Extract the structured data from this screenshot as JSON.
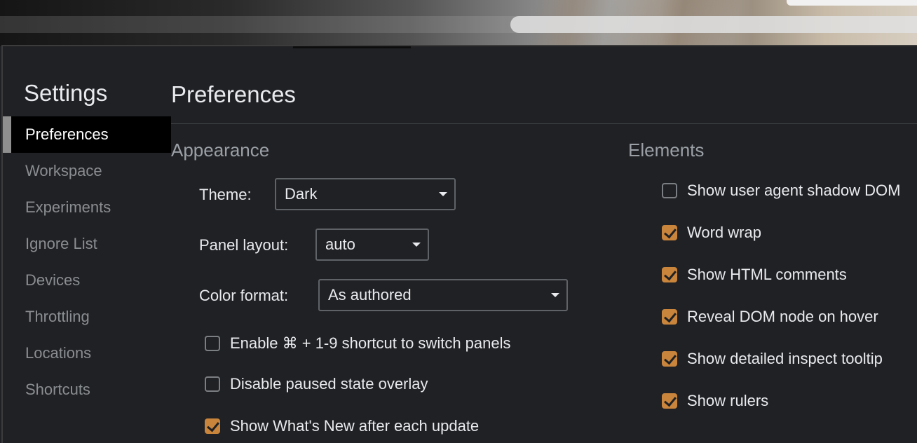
{
  "settings_title": "Settings",
  "sidebar": {
    "items": [
      {
        "label": "Preferences",
        "selected": true
      },
      {
        "label": "Workspace",
        "selected": false
      },
      {
        "label": "Experiments",
        "selected": false
      },
      {
        "label": "Ignore List",
        "selected": false
      },
      {
        "label": "Devices",
        "selected": false
      },
      {
        "label": "Throttling",
        "selected": false
      },
      {
        "label": "Locations",
        "selected": false
      },
      {
        "label": "Shortcuts",
        "selected": false
      }
    ]
  },
  "main": {
    "title": "Preferences",
    "appearance": {
      "heading": "Appearance",
      "theme": {
        "label": "Theme:",
        "value": "Dark"
      },
      "panel_layout": {
        "label": "Panel layout:",
        "value": "auto"
      },
      "color_format": {
        "label": "Color format:",
        "value": "As authored"
      },
      "options": [
        {
          "label": "Enable ⌘ + 1-9 shortcut to switch panels",
          "checked": false
        },
        {
          "label": "Disable paused state overlay",
          "checked": false
        },
        {
          "label": "Show What's New after each update",
          "checked": true
        }
      ]
    },
    "elements": {
      "heading": "Elements",
      "options": [
        {
          "label": "Show user agent shadow DOM",
          "checked": false
        },
        {
          "label": "Word wrap",
          "checked": true
        },
        {
          "label": "Show HTML comments",
          "checked": true
        },
        {
          "label": "Reveal DOM node on hover",
          "checked": true
        },
        {
          "label": "Show detailed inspect tooltip",
          "checked": true
        },
        {
          "label": "Show rulers",
          "checked": true
        }
      ]
    }
  },
  "colors": {
    "background": "#202124",
    "accent_checkbox": "#c9853c",
    "selected_item_bg": "#000000",
    "muted_text": "#8a8d91"
  }
}
